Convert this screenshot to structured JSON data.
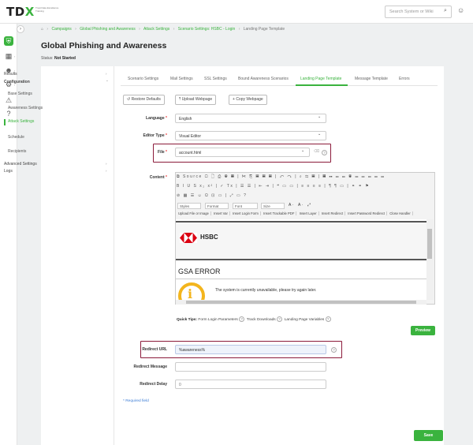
{
  "header": {
    "logo_main": "TDX",
    "logo_sub": "Trust Data Excellence Training",
    "search_placeholder": "Search System or Wiki",
    "search_icon": "search-icon",
    "user_icon": "user-icon"
  },
  "sidebar": {
    "collapse_glyph": "›",
    "items": [
      {
        "icon": "shield-icon",
        "glyph": "⛨",
        "active": true
      },
      {
        "icon": "grid-icon",
        "glyph": "▦",
        "active": false
      },
      {
        "icon": "users-icon",
        "glyph": "☻",
        "active": false
      },
      {
        "icon": "gear-icon",
        "glyph": "⚙",
        "active": false
      },
      {
        "icon": "alert-icon",
        "glyph": "⚠",
        "active": false
      },
      {
        "icon": "help-icon",
        "glyph": "?",
        "active": false
      }
    ]
  },
  "breadcrumb": {
    "home_glyph": "⌂",
    "items": [
      "Campaigns",
      "Global Phishing and Awareness",
      "Attack Settings",
      "Scenario Settings: HSBC - Login"
    ],
    "current": "Landing Page Template",
    "separator": "›"
  },
  "page": {
    "title": "Global Phishing and Awareness",
    "status_label": "Status:",
    "status_value": "Not Started"
  },
  "leftnav": {
    "results": "Results",
    "configuration": "Configuration",
    "base_settings": "Base Settings",
    "awareness_settings": "Awareness Settings",
    "attack_settings": "Attack Settings",
    "schedule": "Schedule",
    "recipients": "Recipients",
    "advanced_settings": "Advanced Settings",
    "logs": "Logs",
    "arrow_right": "›",
    "arrow_down": "⌄"
  },
  "tabs": [
    "Scenario Settings",
    "Mail Settings",
    "SSL Settings",
    "Bound Awareness Scenarios",
    "Landing Page Template",
    "Message Template",
    "Errors"
  ],
  "actions": {
    "restore": "Restore Defaults",
    "upload": "Upload Webpage",
    "copy": "Copy Webpage",
    "restore_glyph": "↺",
    "upload_glyph": "⤒",
    "copy_glyph": "+"
  },
  "form": {
    "language_label": "Language",
    "language_value": "English",
    "editor_type_label": "Editor Type",
    "editor_type_value": "Visual Editor",
    "file_label": "File",
    "file_value": "account.html",
    "content_label": "Content",
    "required_mark": "*",
    "chevron": "⌄",
    "help_glyph": "?",
    "trash_glyph": "⌫"
  },
  "editor": {
    "toolbar_row1": "⧉ Source ▢ 🗋 ⎙ ◉ ▦ | ✂ ⎘ ▤ ▤ ▤ | ↶ ↷ | ⌕ ⇆ ▤ | ▦ ☷ ▭ ▭ ◉ ▭ ▭ ▭ ▭ ▭",
    "toolbar_row2": "B I U S x₂ x² | ✓ Tx | ☰ ☰ | ⇤ ⇥ | ❝ ▭ ▭ | ≡ ≡ ≡ ≡ | ¶ ¶ ▭ | ⚭ ⚭ ⚑",
    "toolbar_row3": "⊘ ▦ ☰ ☺ Ω ⊡ ▭ | ⤢ ▭ ?",
    "styles": "Styles",
    "format": "Format",
    "font": "Font",
    "size": "Size",
    "color_a": "A·",
    "bg_a": "A·",
    "expand": "⤢",
    "insert_buttons": [
      "Upload File or Image",
      "Insert Var",
      "Insert Login Form",
      "Insert Trackable PDF",
      "Insert Layer",
      "Insert Redirect",
      "Insert Password Redirect",
      "Close Handler"
    ],
    "preview": {
      "brand": "HSBC",
      "error_title": "GSA ERROR",
      "error_message": "The system is currently unavailable, please try again later.",
      "info_glyph": "i",
      "brand_red": "#db0011"
    }
  },
  "tips": {
    "label": "Quick Tips:",
    "items": [
      "Form Login Parameters",
      "Track Downloads",
      "Landing Page Variables"
    ]
  },
  "preview_button": "Preview",
  "redirect": {
    "url_label": "Redirect URL",
    "url_value": "%awareness%",
    "message_label": "Redirect Message",
    "message_value": "",
    "delay_label": "Redirect Delay",
    "delay_value": "0"
  },
  "required_note": "* Required field",
  "save_button": "Save",
  "colors": {
    "accent": "#3ab33e",
    "highlight_border": "#8b1a3a",
    "warning": "#f3b51d"
  }
}
